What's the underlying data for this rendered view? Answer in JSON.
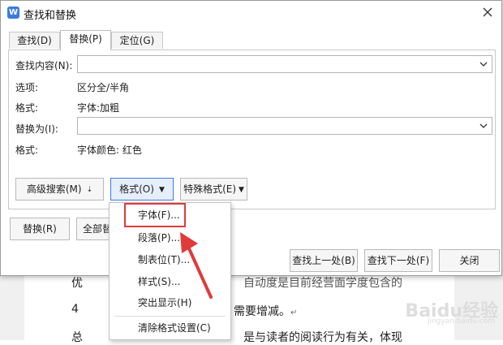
{
  "dialog": {
    "title": "查找和替换",
    "tabs": [
      {
        "label": "查找(D)",
        "active": false
      },
      {
        "label": "替换(P)",
        "active": true
      },
      {
        "label": "定位(G)",
        "active": false
      }
    ],
    "find_label": "查找内容(N):",
    "find_value": "",
    "options_label": "选项:",
    "options_value": "区分全/半角",
    "format_label1": "格式:",
    "format_value1": "字体:加粗",
    "replace_label": "替换为(I):",
    "replace_value": "",
    "format_label2": "格式:",
    "format_value2": "字体颜色: 红色"
  },
  "buttons": {
    "advanced": "高级搜索(M)",
    "format": "格式(O)",
    "special": "特殊格式(E)",
    "replace": "替换(R)",
    "replace_all": "全部替",
    "find_prev": "查找上一处(B)",
    "find_next": "查找下一处(F)",
    "close": "关闭"
  },
  "format_menu": {
    "items": [
      "字体(F)...",
      "段落(P)...",
      "制表位(T)...",
      "样式(S)...",
      "突出显示(H)"
    ],
    "clear": "清除格式设置(C)"
  },
  "background_doc": {
    "line1": "优",
    "line1b": "自动度是目前经营面学度包含的",
    "line2": "4",
    "line2b": "需要增减。",
    "line3": "总",
    "line3b": "是与读者的阅读行为有关，体现",
    "mark": "↵"
  },
  "watermark": {
    "text": "Baidu经验",
    "sub": "jingyan.baidu.com"
  },
  "colors": {
    "accent": "#3a7de0",
    "highlight": "#e03a3a",
    "app_icon": "#3b7be0"
  },
  "icons": {
    "app": "wps-writer-icon",
    "close": "close-icon",
    "dropdown": "chevron-down-icon"
  }
}
